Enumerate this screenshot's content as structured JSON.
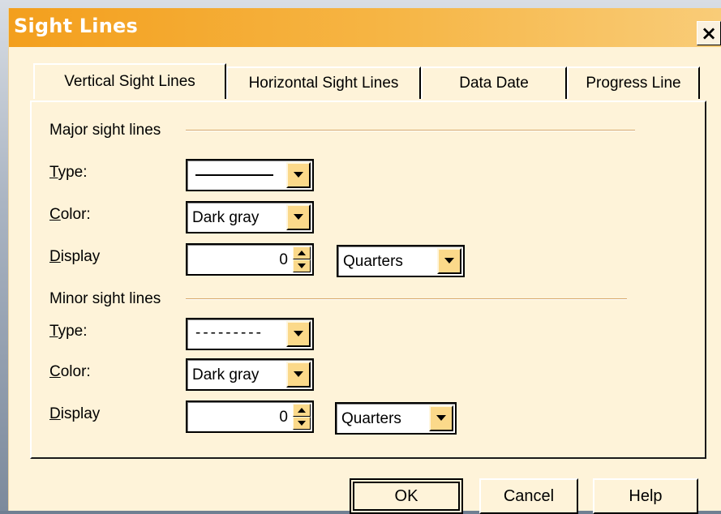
{
  "dialog": {
    "title": "Sight Lines",
    "close_symbol": "×"
  },
  "tabs": [
    {
      "label": "Vertical Sight Lines",
      "active": true
    },
    {
      "label": "Horizontal Sight Lines",
      "active": false
    },
    {
      "label": "Data Date",
      "active": false
    },
    {
      "label": "Progress Line",
      "active": false
    }
  ],
  "major": {
    "section_label": "Major sight lines",
    "type_label": {
      "mnemonic": "T",
      "rest": "ype:"
    },
    "type_value_style": "solid",
    "color_label": {
      "mnemonic": "C",
      "rest": "olor:"
    },
    "color_value": "Dark gray",
    "display_label": {
      "mnemonic": "D",
      "rest": "isplay"
    },
    "display_value": "0",
    "display_unit": "Quarters"
  },
  "minor": {
    "section_label": "Minor sight lines",
    "type_label": {
      "mnemonic": "T",
      "rest": "ype:"
    },
    "type_value_style": "dashed",
    "type_dash_text": "---------",
    "color_label": {
      "mnemonic": "C",
      "rest": "olor:"
    },
    "color_value": "Dark gray",
    "display_label": {
      "mnemonic": "D",
      "rest": "isplay"
    },
    "display_value": "0",
    "display_unit": "Quarters"
  },
  "buttons": {
    "ok": "OK",
    "cancel": "Cancel",
    "help": "Help"
  },
  "colors": {
    "title_bar": "#f39f1d",
    "dialog_background": "#fef3d9",
    "dropdown_button": "#fbd98a"
  },
  "icons": {
    "dropdown": "chevron-down-icon",
    "spin_up": "arrow-up-icon",
    "spin_down": "arrow-down-icon",
    "close": "close-icon"
  }
}
